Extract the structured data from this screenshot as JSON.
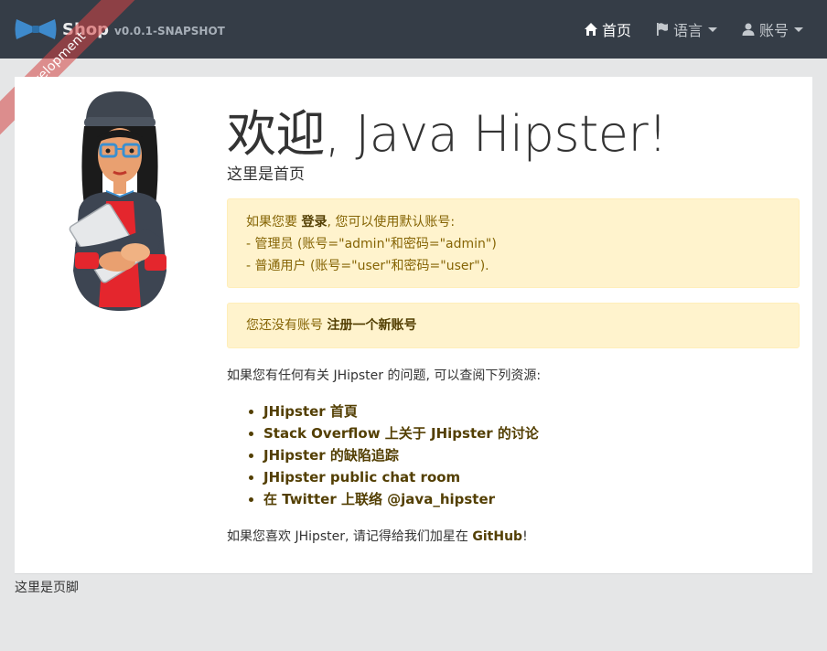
{
  "navbar": {
    "brand_name": "Shop",
    "version": "v0.0.1-SNAPSHOT",
    "home_label": "首页",
    "language_label": "语言",
    "account_label": "账号",
    "icons": {
      "home": "home-icon",
      "flag": "flag-icon",
      "user": "user-icon"
    },
    "bg_color": "#353d47"
  },
  "ribbon": {
    "label": "Development"
  },
  "main": {
    "title": "欢迎, Java Hipster!",
    "subtitle": "这里是首页",
    "login_alert": {
      "prefix": "如果您要 ",
      "login_link": "登录",
      "suffix": ", 您可以使用默认账号:",
      "admin_line": "- 管理员 (账号=\"admin\"和密码=\"admin\")",
      "user_line": "- 普通用户 (账号=\"user\"和密码=\"user\")."
    },
    "register_alert": {
      "text": "您还没有账号 ",
      "link": "注册一个新账号"
    },
    "question": "如果您有任何有关 JHipster 的问题, 可以查阅下列资源:",
    "links": [
      "JHipster 首頁",
      "Stack Overflow 上关于 JHipster 的讨论",
      "JHipster 的缺陷追踪",
      "JHipster public chat room",
      "在 Twitter 上联络 @java_hipster"
    ],
    "github": {
      "prefix": "如果您喜欢 JHipster, 请记得给我们加星在 ",
      "link": "GitHub",
      "suffix": "!"
    }
  },
  "footer": {
    "text": "这里是页脚"
  },
  "colors": {
    "alert_bg": "#fff3cd",
    "alert_text": "#856404",
    "link": "#533f03"
  }
}
